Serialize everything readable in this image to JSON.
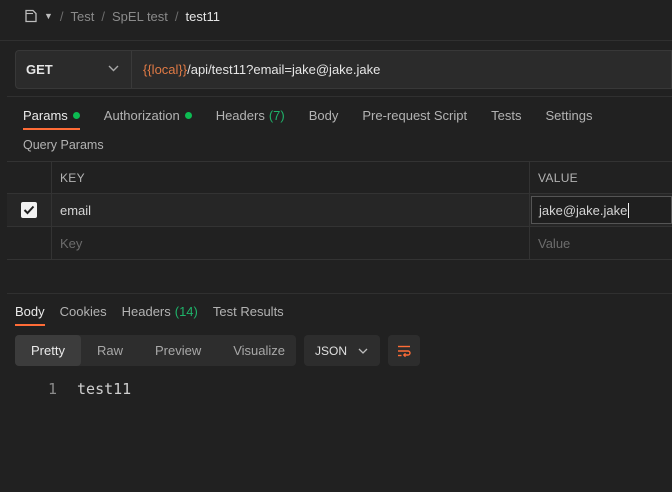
{
  "breadcrumb": {
    "items": [
      "Test",
      "SpEL test"
    ],
    "current": "test11",
    "separator": "/"
  },
  "request": {
    "method": "GET",
    "url_variable": "{{local}}",
    "url_rest": "/api/test11?email=jake@jake.jake"
  },
  "request_tabs": [
    {
      "label": "Params",
      "dot": true,
      "count": ""
    },
    {
      "label": "Authorization",
      "dot": true,
      "count": ""
    },
    {
      "label": "Headers",
      "dot": false,
      "count": "(7)"
    },
    {
      "label": "Body",
      "dot": false,
      "count": ""
    },
    {
      "label": "Pre-request Script",
      "dot": false,
      "count": ""
    },
    {
      "label": "Tests",
      "dot": false,
      "count": ""
    },
    {
      "label": "Settings",
      "dot": false,
      "count": ""
    }
  ],
  "query_params": {
    "title": "Query Params",
    "columns": {
      "key": "KEY",
      "value": "VALUE"
    },
    "rows": [
      {
        "checked": true,
        "key": "email",
        "value": "jake@jake.jake"
      }
    ],
    "placeholder": {
      "key": "Key",
      "value": "Value"
    }
  },
  "response_tabs": [
    {
      "label": "Body",
      "count": ""
    },
    {
      "label": "Cookies",
      "count": ""
    },
    {
      "label": "Headers",
      "count": "(14)"
    },
    {
      "label": "Test Results",
      "count": ""
    }
  ],
  "view_modes": [
    "Pretty",
    "Raw",
    "Preview",
    "Visualize"
  ],
  "format": "JSON",
  "body_lines": [
    {
      "line": "1",
      "text": "test11"
    }
  ],
  "colors": {
    "accent": "#ff6c37",
    "green_dot": "#0cbb52",
    "variable": "#e07a45"
  },
  "icons": [
    "collection-icon",
    "caret-down-icon",
    "chevron-down-icon",
    "checkmark-icon",
    "wrap-lines-icon"
  ]
}
